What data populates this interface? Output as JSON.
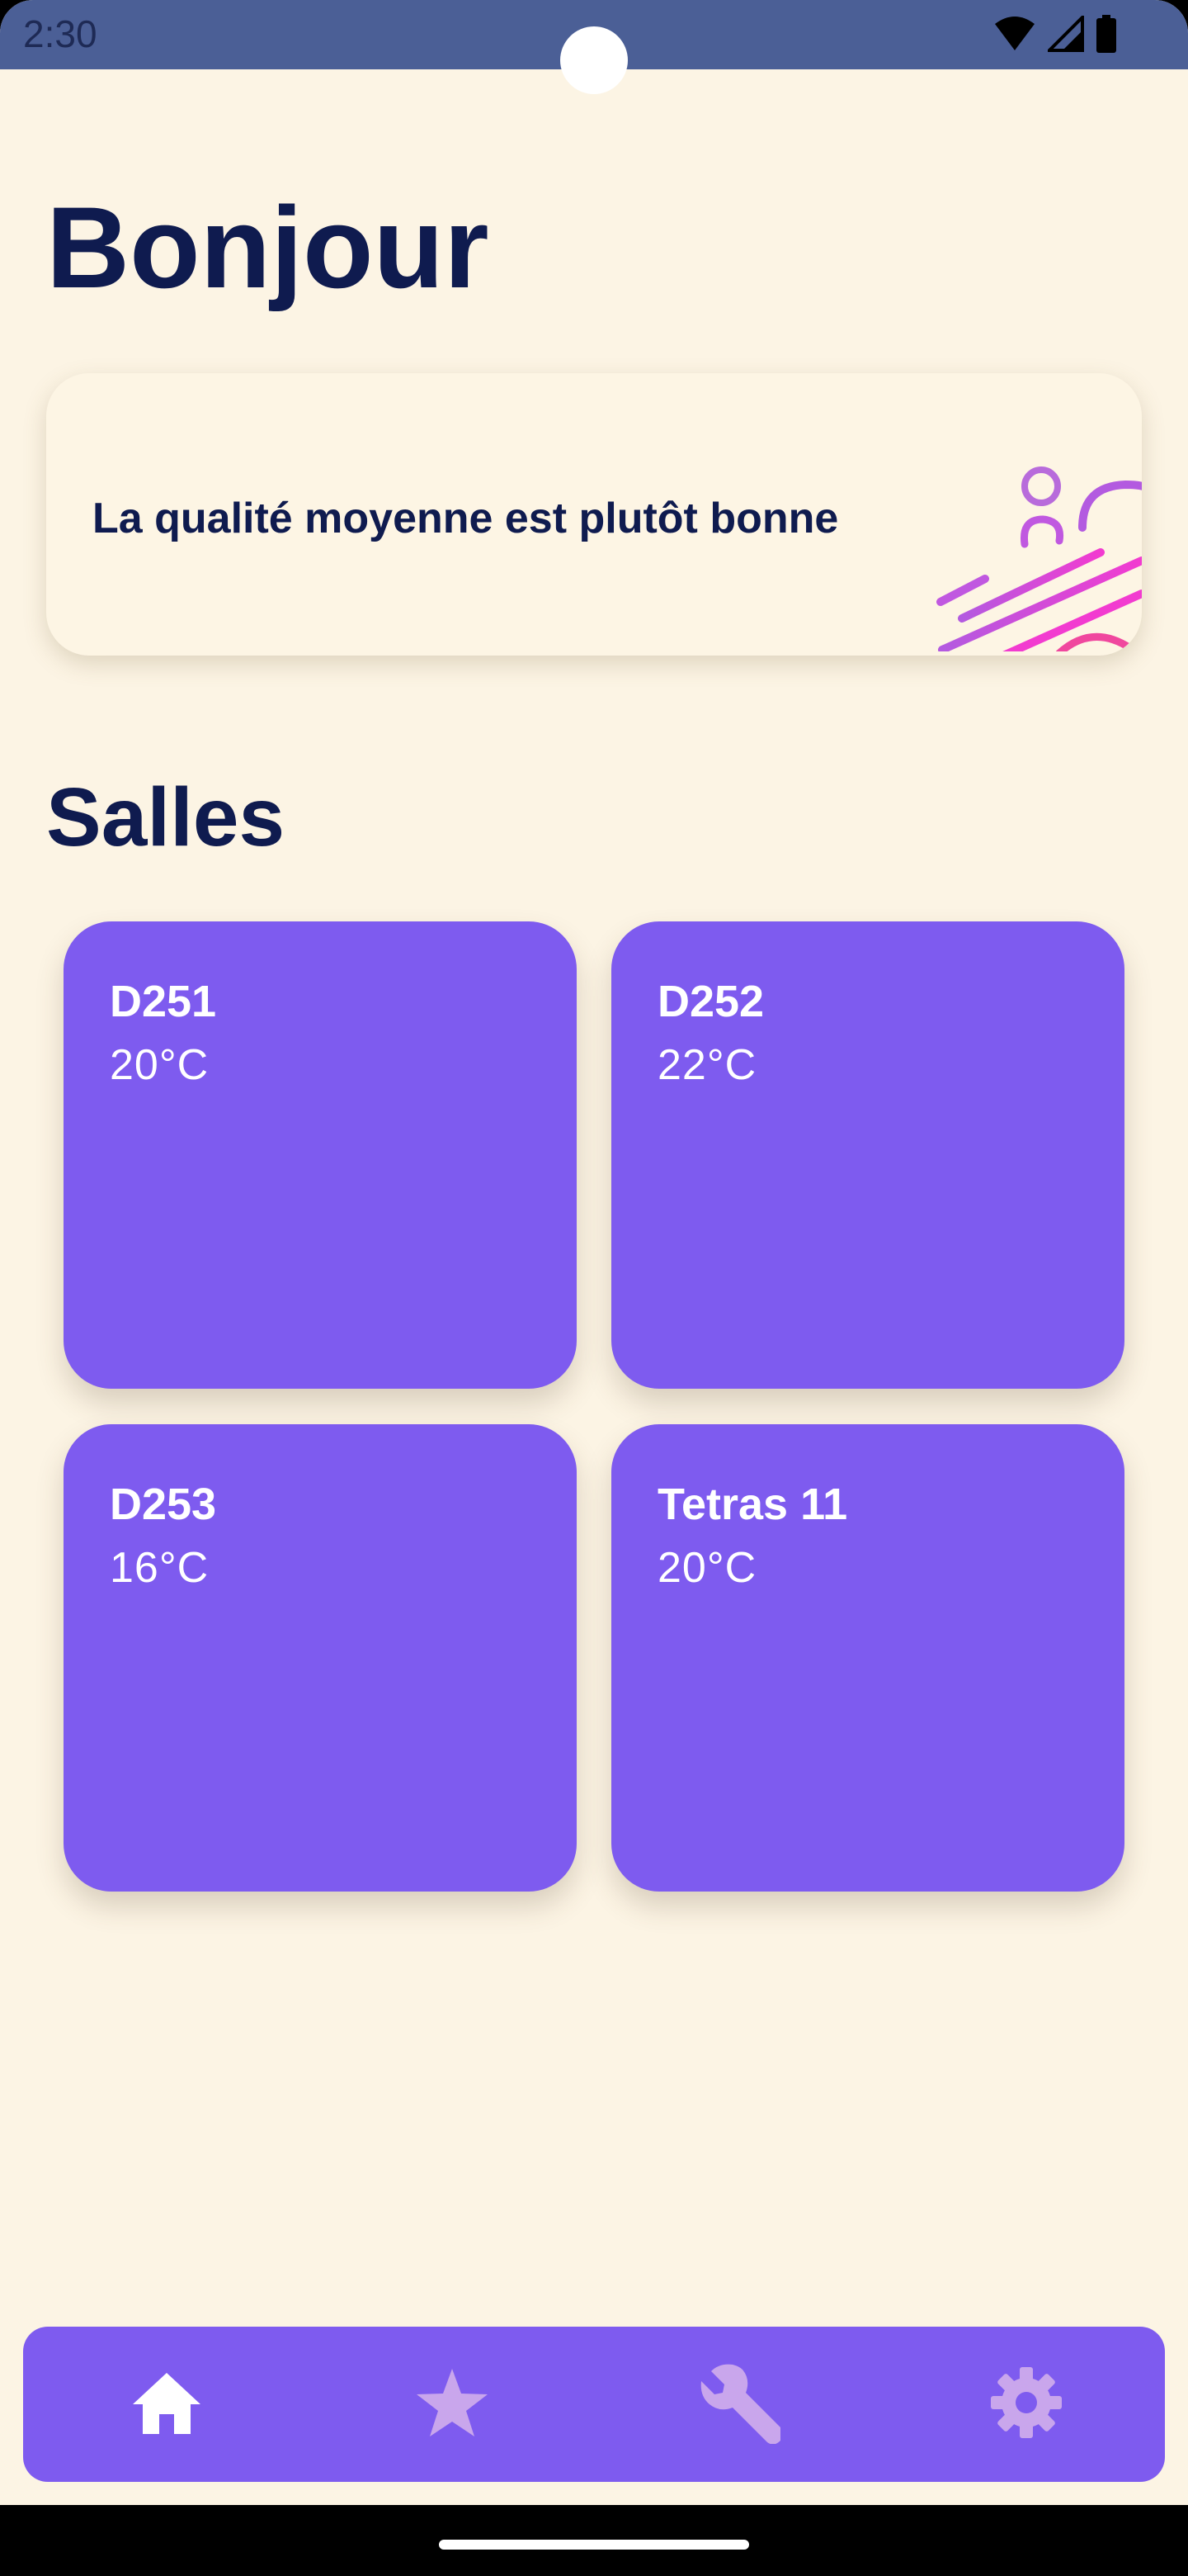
{
  "status_bar": {
    "time": "2:30",
    "icons": [
      "wifi-icon",
      "signal-icon",
      "battery-icon"
    ]
  },
  "greeting": "Bonjour",
  "air_quality": {
    "message": "La qualité moyenne est plutôt bonne"
  },
  "rooms": {
    "title": "Salles",
    "items": [
      {
        "name": "D251",
        "temperature": "20°C"
      },
      {
        "name": "D252",
        "temperature": "22°C"
      },
      {
        "name": "D253",
        "temperature": "16°C"
      },
      {
        "name": "Tetras 11",
        "temperature": "20°C"
      }
    ]
  },
  "bottom_nav": {
    "items": [
      {
        "icon": "home-icon",
        "active": true
      },
      {
        "icon": "star-icon",
        "active": false
      },
      {
        "icon": "wrench-icon",
        "active": false
      },
      {
        "icon": "gear-icon",
        "active": false
      }
    ]
  },
  "colors": {
    "background": "#FCF4E4",
    "primary": "#7E5BEF",
    "heading": "#0F1B4F",
    "status_bar": "#4B5F96",
    "nav_inactive": "#C9A6EC",
    "nav_active": "#FFFFFF"
  }
}
